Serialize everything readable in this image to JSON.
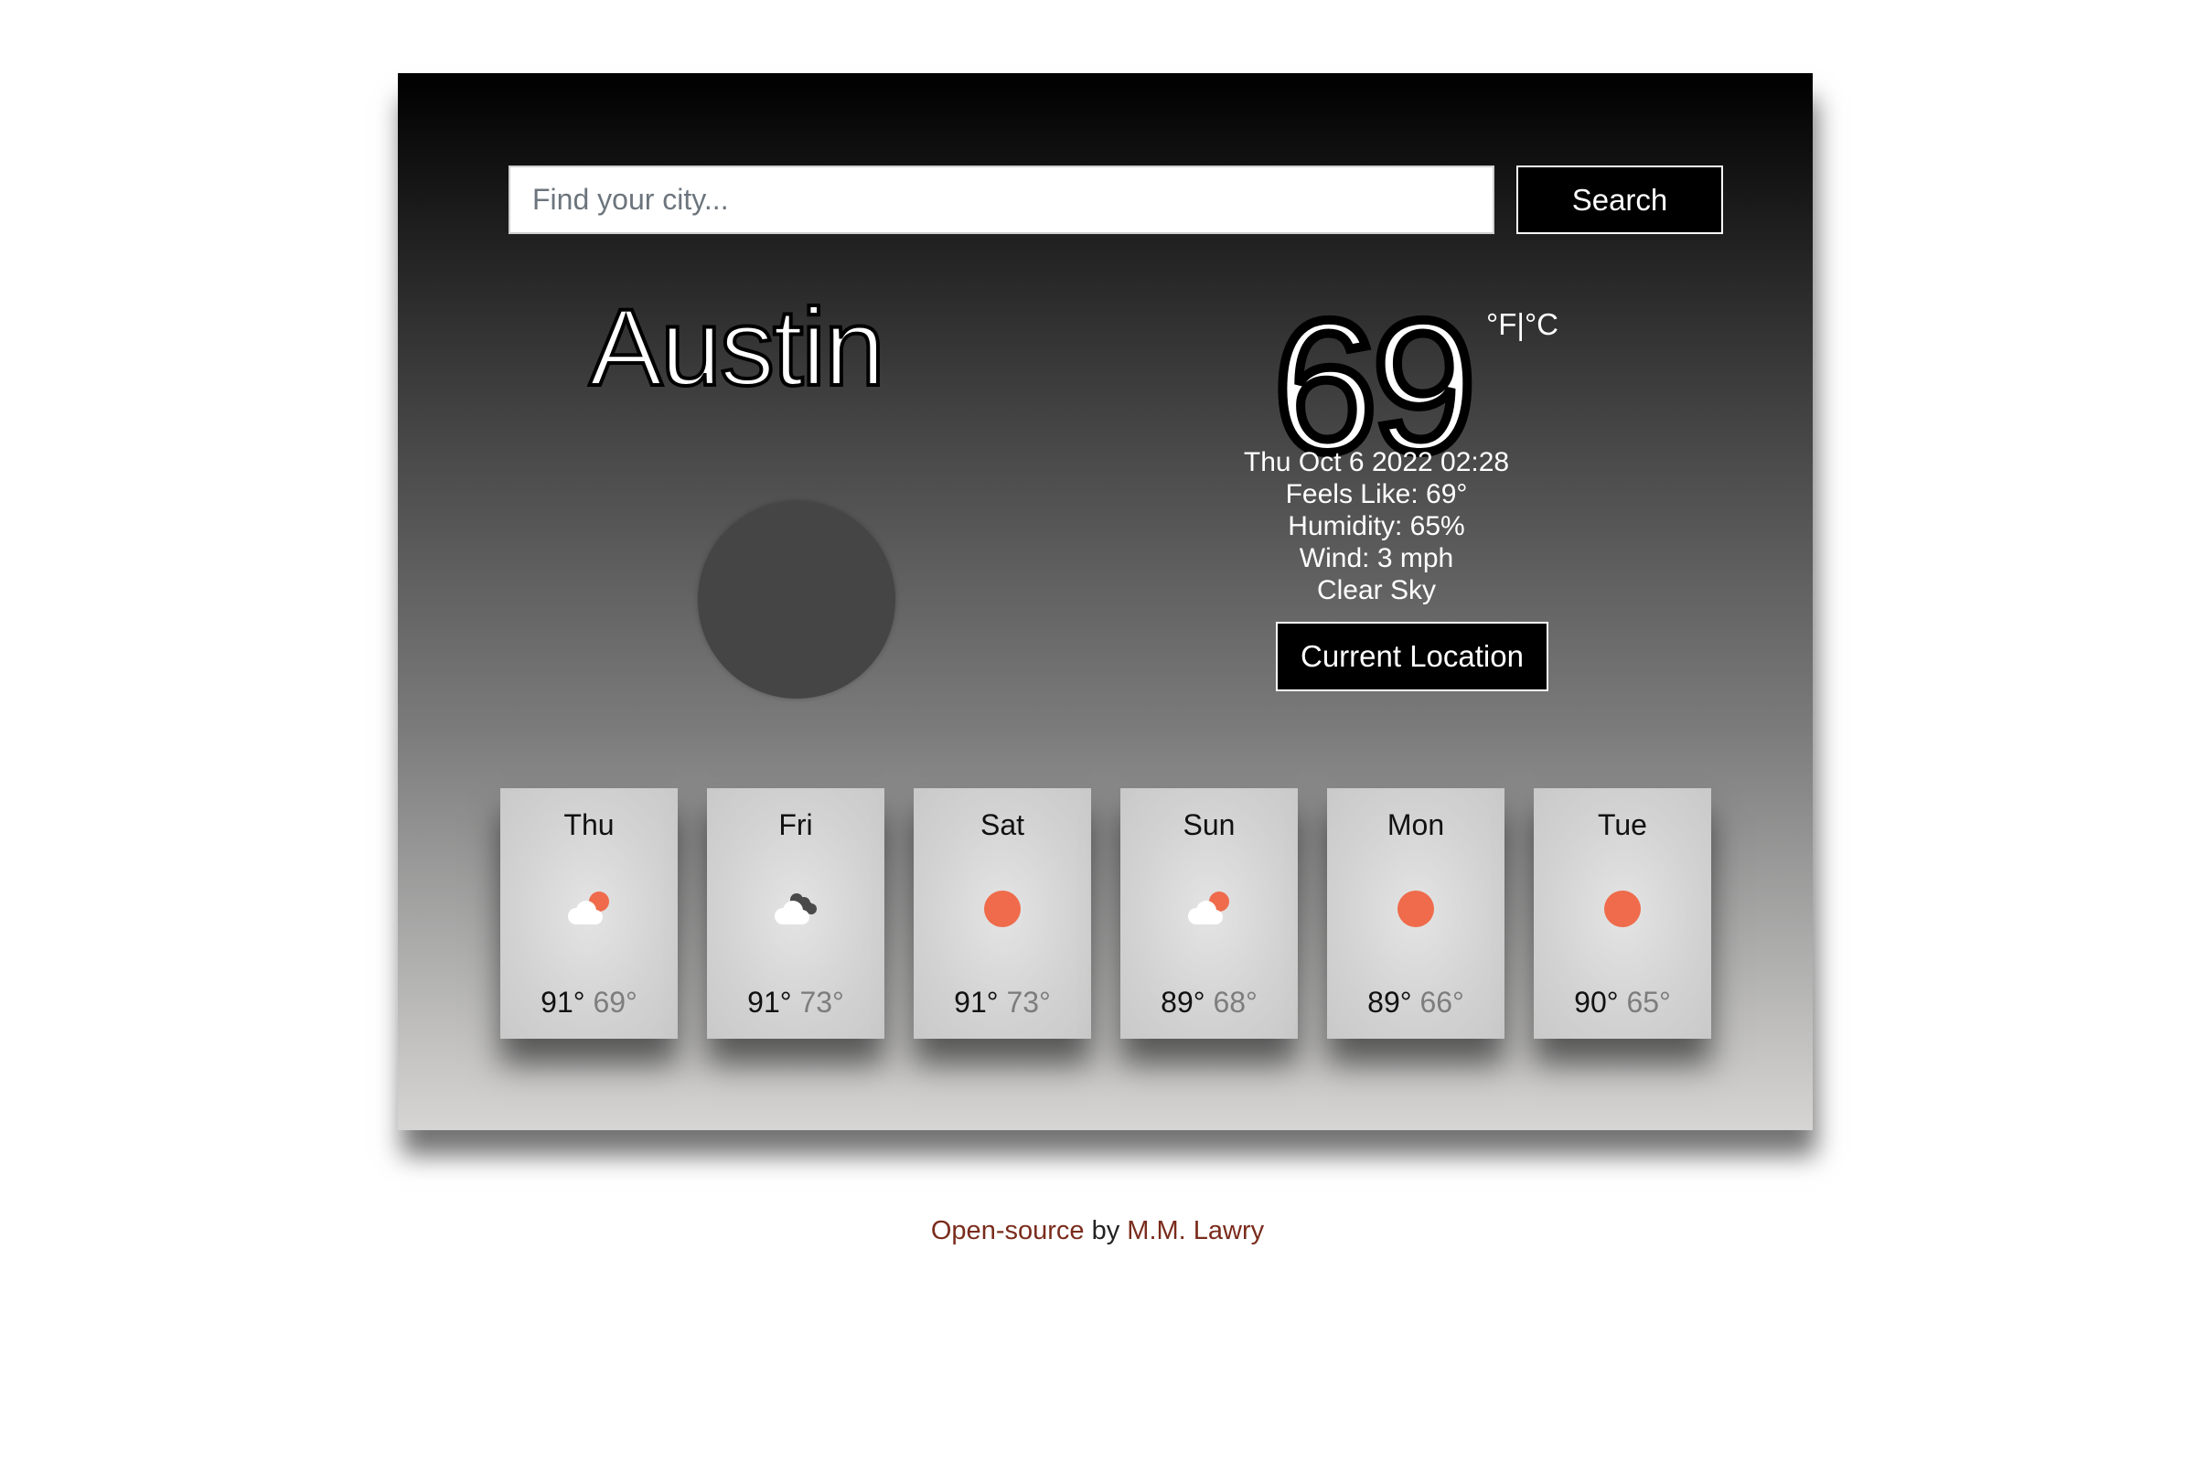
{
  "search": {
    "placeholder": "Find your city...",
    "button_label": "Search"
  },
  "current": {
    "city": "Austin",
    "temperature": "69",
    "unit_f": "°F",
    "unit_separator": "|",
    "unit_c": "°C",
    "datetime": "Thu Oct 6 2022 02:28",
    "feels_like": "Feels Like: 69°",
    "humidity": "Humidity: 65%",
    "wind": "Wind: 3 mph",
    "description": "Clear Sky",
    "location_button_label": "Current Location"
  },
  "forecast": [
    {
      "day": "Thu",
      "icon": "few-clouds-day-icon",
      "max": "91°",
      "min": "69°"
    },
    {
      "day": "Fri",
      "icon": "broken-clouds-icon",
      "max": "91°",
      "min": "73°"
    },
    {
      "day": "Sat",
      "icon": "clear-sky-sun-icon",
      "max": "91°",
      "min": "73°"
    },
    {
      "day": "Sun",
      "icon": "few-clouds-day-icon",
      "max": "89°",
      "min": "68°"
    },
    {
      "day": "Mon",
      "icon": "clear-sky-sun-icon",
      "max": "89°",
      "min": "66°"
    },
    {
      "day": "Tue",
      "icon": "clear-sky-sun-icon",
      "max": "90°",
      "min": "65°"
    }
  ],
  "footer": {
    "link_opensource": "Open-source",
    "by": " by ",
    "link_author": "M.M. Lawry"
  },
  "colors": {
    "sun": "#ef6b4b",
    "cloud": "#ffffff",
    "dark_cloud": "#555555",
    "footer_link": "#7a2c1c"
  }
}
